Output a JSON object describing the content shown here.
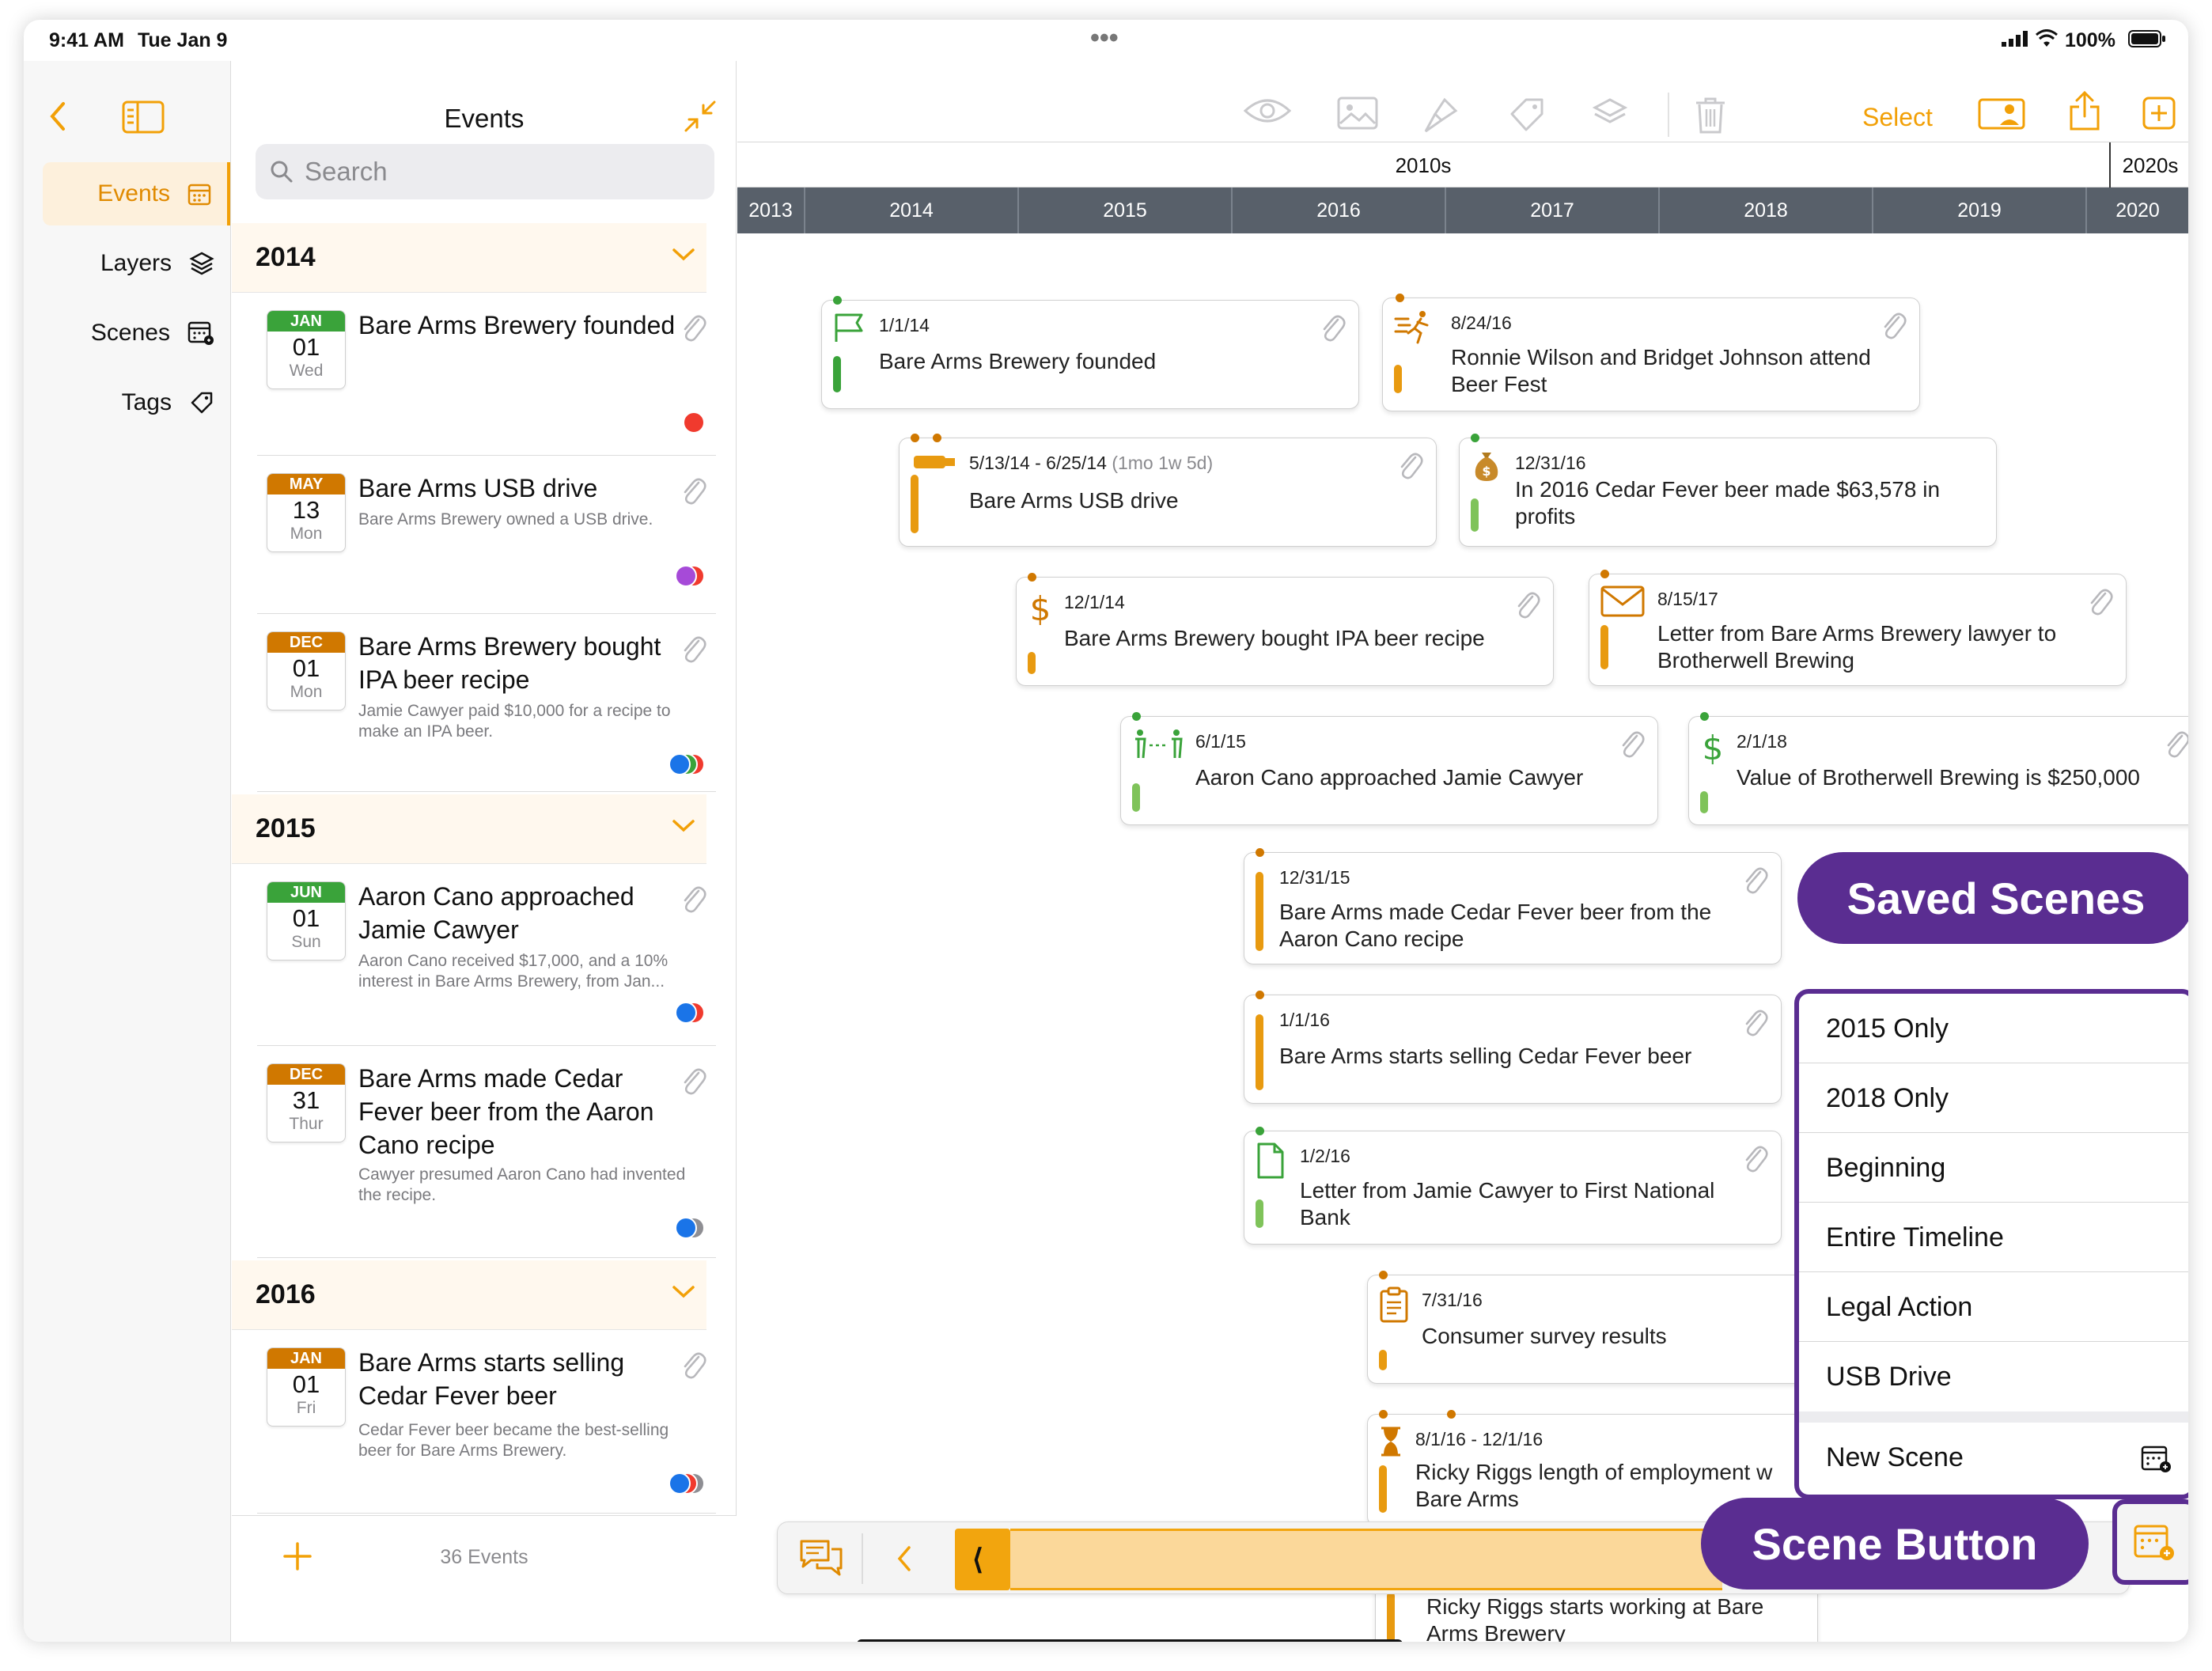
{
  "status_bar": {
    "time": "9:41 AM",
    "date": "Tue Jan 9",
    "battery": "100%",
    "more": "•••"
  },
  "sidebar": {
    "items": [
      {
        "label": "Events",
        "icon": "calendar-icon",
        "active": true
      },
      {
        "label": "Layers",
        "icon": "layers-icon"
      },
      {
        "label": "Scenes",
        "icon": "scenes-icon"
      },
      {
        "label": "Tags",
        "icon": "tag-icon"
      }
    ]
  },
  "list": {
    "title": "Events",
    "search_placeholder": "Search",
    "sections": [
      {
        "year": "2014",
        "events": [
          {
            "month": "JAN",
            "day": "01",
            "weekday": "Wed",
            "title": "Bare Arms Brewery founded",
            "desc": ""
          },
          {
            "month": "MAY",
            "day": "13",
            "weekday": "Mon",
            "title": "Bare Arms USB drive",
            "desc": "Bare Arms Brewery owned a USB drive."
          },
          {
            "month": "DEC",
            "day": "01",
            "weekday": "Mon",
            "title": "Bare Arms Brewery bought IPA beer recipe",
            "desc": "Jamie Cawyer paid $10,000 for a recipe to make an IPA beer."
          }
        ]
      },
      {
        "year": "2015",
        "events": [
          {
            "month": "JUN",
            "day": "01",
            "weekday": "Sun",
            "title": "Aaron Cano approached Jamie Cawyer",
            "desc": "Aaron Cano received $17,000, and a 10% interest in Bare Arms Brewery, from Jan..."
          },
          {
            "month": "DEC",
            "day": "31",
            "weekday": "Thur",
            "title": "Bare Arms made Cedar Fever beer from the Aaron Cano recipe",
            "desc": "Cawyer presumed Aaron Cano had invented the recipe."
          }
        ]
      },
      {
        "year": "2016",
        "events": [
          {
            "month": "JAN",
            "day": "01",
            "weekday": "Fri",
            "title": "Bare Arms starts selling Cedar Fever beer",
            "desc": "Cedar Fever beer became the best-selling beer for Bare Arms Brewery."
          }
        ]
      }
    ],
    "footer_count": "36 Events"
  },
  "toolbar": {
    "select_label": "Select"
  },
  "timeline": {
    "decades": [
      "2010s",
      "2020s"
    ],
    "years": [
      "2013",
      "2014",
      "2015",
      "2016",
      "2017",
      "2018",
      "2019",
      "2020"
    ],
    "cards": [
      {
        "date": "1/1/14",
        "title": "Bare Arms Brewery founded"
      },
      {
        "date": "8/24/16",
        "title": "Ronnie Wilson and Bridget Johnson attend Beer Fest"
      },
      {
        "date": "5/13/14 - 6/25/14",
        "duration": "(1mo 1w 5d)",
        "title": "Bare Arms USB drive"
      },
      {
        "date": "12/31/16",
        "title": "In 2016 Cedar Fever beer made $63,578 in profits"
      },
      {
        "date": "12/1/14",
        "title": "Bare Arms Brewery bought IPA beer recipe"
      },
      {
        "date": "8/15/17",
        "title": "Letter from Bare Arms Brewery lawyer to Brotherwell Brewing"
      },
      {
        "date": "6/1/15",
        "title": "Aaron Cano approached Jamie Cawyer"
      },
      {
        "date": "2/1/18",
        "title": "Value of Brotherwell Brewing is $250,000"
      },
      {
        "date": "12/31/15",
        "title": "Bare Arms made Cedar Fever beer from the Aaron Cano recipe"
      },
      {
        "date": "1/1/16",
        "title": "Bare Arms starts selling Cedar Fever beer"
      },
      {
        "date": "1/2/16",
        "title": "Letter from Jamie Cawyer to First National Bank"
      },
      {
        "date": "7/31/16",
        "title": "Consumer survey results"
      },
      {
        "date": "8/1/16 - 12/1/16",
        "title": "Ricky Riggs length of employment w Bare Arms"
      },
      {
        "date": "",
        "title": "Ricky Riggs starts working at Bare Arms Brewery"
      }
    ]
  },
  "callouts": {
    "saved_scenes": "Saved Scenes",
    "scene_button": "Scene Button"
  },
  "scenes_menu": {
    "items": [
      "2015 Only",
      "2018 Only",
      "Beginning",
      "Entire Timeline",
      "Legal Action",
      "USB Drive"
    ],
    "new_scene": "New Scene"
  },
  "colors": {
    "accent": "#f2a007",
    "purple": "#5a2d91",
    "green": "#3aa33a",
    "orange": "#e08a00",
    "year_bar": "#58606a"
  }
}
